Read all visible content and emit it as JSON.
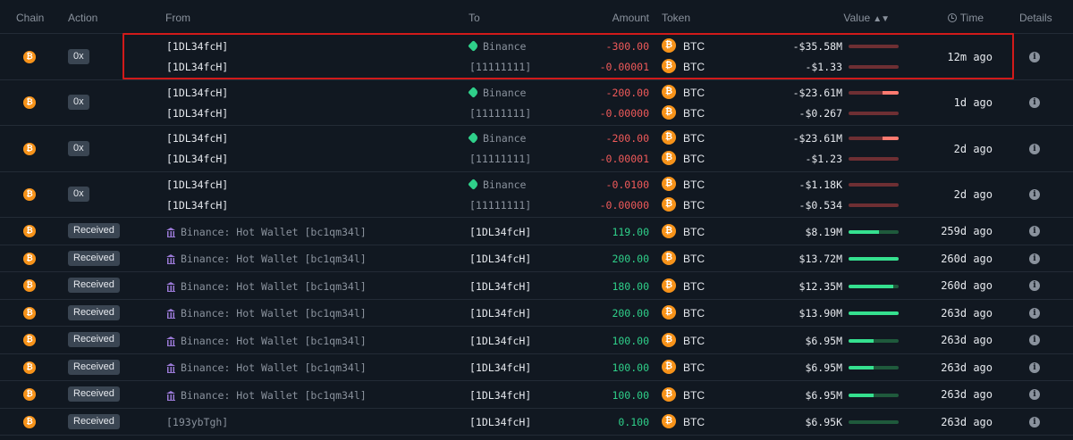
{
  "header": {
    "chain": "Chain",
    "action": "Action",
    "from": "From",
    "to": "To",
    "amount": "Amount",
    "token": "Token",
    "value": "Value",
    "time": "Time",
    "details": "Details"
  },
  "icons": {
    "chain": "bitcoin-icon",
    "details": "info-icon",
    "to_tag": "tag-icon",
    "from_entity": "bank-icon",
    "sort": "sort-icon",
    "clock": "clock-icon"
  },
  "colors": {
    "negative": "#f05a5a",
    "positive": "#2fd08a",
    "btc": "#f7931a",
    "highlight": "#d11a1a",
    "entity_icon": "#9b7ad8"
  },
  "rows": [
    {
      "action": "0x",
      "time": "12m ago",
      "highlighted": true,
      "lines": [
        {
          "from": "[1DL34fcH]",
          "from_style": "bright",
          "to": "Binance",
          "to_style": "entity",
          "amount": "-300.00",
          "sign": "neg",
          "token": "BTC",
          "value": "-$35.58M",
          "bar": 0.0
        },
        {
          "from": "[1DL34fcH]",
          "from_style": "bright",
          "to": "[11111111]",
          "to_style": "muted",
          "amount": "-0.00001",
          "sign": "neg",
          "token": "BTC",
          "value": "-$1.33",
          "bar": 0.0
        }
      ]
    },
    {
      "action": "0x",
      "time": "1d ago",
      "lines": [
        {
          "from": "[1DL34fcH]",
          "from_style": "bright",
          "to": "Binance",
          "to_style": "entity",
          "amount": "-200.00",
          "sign": "neg",
          "token": "BTC",
          "value": "-$23.61M",
          "bar": 0.33
        },
        {
          "from": "[1DL34fcH]",
          "from_style": "bright",
          "to": "[11111111]",
          "to_style": "muted",
          "amount": "-0.00000",
          "sign": "neg",
          "token": "BTC",
          "value": "-$0.267",
          "bar": 0.0
        }
      ]
    },
    {
      "action": "0x",
      "time": "2d ago",
      "lines": [
        {
          "from": "[1DL34fcH]",
          "from_style": "bright",
          "to": "Binance",
          "to_style": "entity",
          "amount": "-200.00",
          "sign": "neg",
          "token": "BTC",
          "value": "-$23.61M",
          "bar": 0.33
        },
        {
          "from": "[1DL34fcH]",
          "from_style": "bright",
          "to": "[11111111]",
          "to_style": "muted",
          "amount": "-0.00001",
          "sign": "neg",
          "token": "BTC",
          "value": "-$1.23",
          "bar": 0.0
        }
      ]
    },
    {
      "action": "0x",
      "time": "2d ago",
      "lines": [
        {
          "from": "[1DL34fcH]",
          "from_style": "bright",
          "to": "Binance",
          "to_style": "entity",
          "amount": "-0.0100",
          "sign": "neg",
          "token": "BTC",
          "value": "-$1.18K",
          "bar": 0.0
        },
        {
          "from": "[1DL34fcH]",
          "from_style": "bright",
          "to": "[11111111]",
          "to_style": "muted",
          "amount": "-0.00000",
          "sign": "neg",
          "token": "BTC",
          "value": "-$0.534",
          "bar": 0.0
        }
      ]
    },
    {
      "action": "Received",
      "time": "259d ago",
      "lines": [
        {
          "from": "Binance: Hot Wallet [bc1qm34l]",
          "from_style": "entity",
          "to": "[1DL34fcH]",
          "to_style": "bright",
          "amount": "119.00",
          "sign": "pos",
          "token": "BTC",
          "value": "$8.19M",
          "bar": 0.6
        }
      ]
    },
    {
      "action": "Received",
      "time": "260d ago",
      "lines": [
        {
          "from": "Binance: Hot Wallet [bc1qm34l]",
          "from_style": "entity",
          "to": "[1DL34fcH]",
          "to_style": "bright",
          "amount": "200.00",
          "sign": "pos",
          "token": "BTC",
          "value": "$13.72M",
          "bar": 1.0
        }
      ]
    },
    {
      "action": "Received",
      "time": "260d ago",
      "lines": [
        {
          "from": "Binance: Hot Wallet [bc1qm34l]",
          "from_style": "entity",
          "to": "[1DL34fcH]",
          "to_style": "bright",
          "amount": "180.00",
          "sign": "pos",
          "token": "BTC",
          "value": "$12.35M",
          "bar": 0.9
        }
      ]
    },
    {
      "action": "Received",
      "time": "263d ago",
      "lines": [
        {
          "from": "Binance: Hot Wallet [bc1qm34l]",
          "from_style": "entity",
          "to": "[1DL34fcH]",
          "to_style": "bright",
          "amount": "200.00",
          "sign": "pos",
          "token": "BTC",
          "value": "$13.90M",
          "bar": 1.0
        }
      ]
    },
    {
      "action": "Received",
      "time": "263d ago",
      "lines": [
        {
          "from": "Binance: Hot Wallet [bc1qm34l]",
          "from_style": "entity",
          "to": "[1DL34fcH]",
          "to_style": "bright",
          "amount": "100.00",
          "sign": "pos",
          "token": "BTC",
          "value": "$6.95M",
          "bar": 0.5
        }
      ]
    },
    {
      "action": "Received",
      "time": "263d ago",
      "lines": [
        {
          "from": "Binance: Hot Wallet [bc1qm34l]",
          "from_style": "entity",
          "to": "[1DL34fcH]",
          "to_style": "bright",
          "amount": "100.00",
          "sign": "pos",
          "token": "BTC",
          "value": "$6.95M",
          "bar": 0.5
        }
      ]
    },
    {
      "action": "Received",
      "time": "263d ago",
      "lines": [
        {
          "from": "Binance: Hot Wallet [bc1qm34l]",
          "from_style": "entity",
          "to": "[1DL34fcH]",
          "to_style": "bright",
          "amount": "100.00",
          "sign": "pos",
          "token": "BTC",
          "value": "$6.95M",
          "bar": 0.5
        }
      ]
    },
    {
      "action": "Received",
      "time": "263d ago",
      "lines": [
        {
          "from": "[193ybTgh]",
          "from_style": "muted",
          "to": "[1DL34fcH]",
          "to_style": "bright",
          "amount": "0.100",
          "sign": "pos",
          "token": "BTC",
          "value": "$6.95K",
          "bar": 0.0
        }
      ]
    }
  ]
}
